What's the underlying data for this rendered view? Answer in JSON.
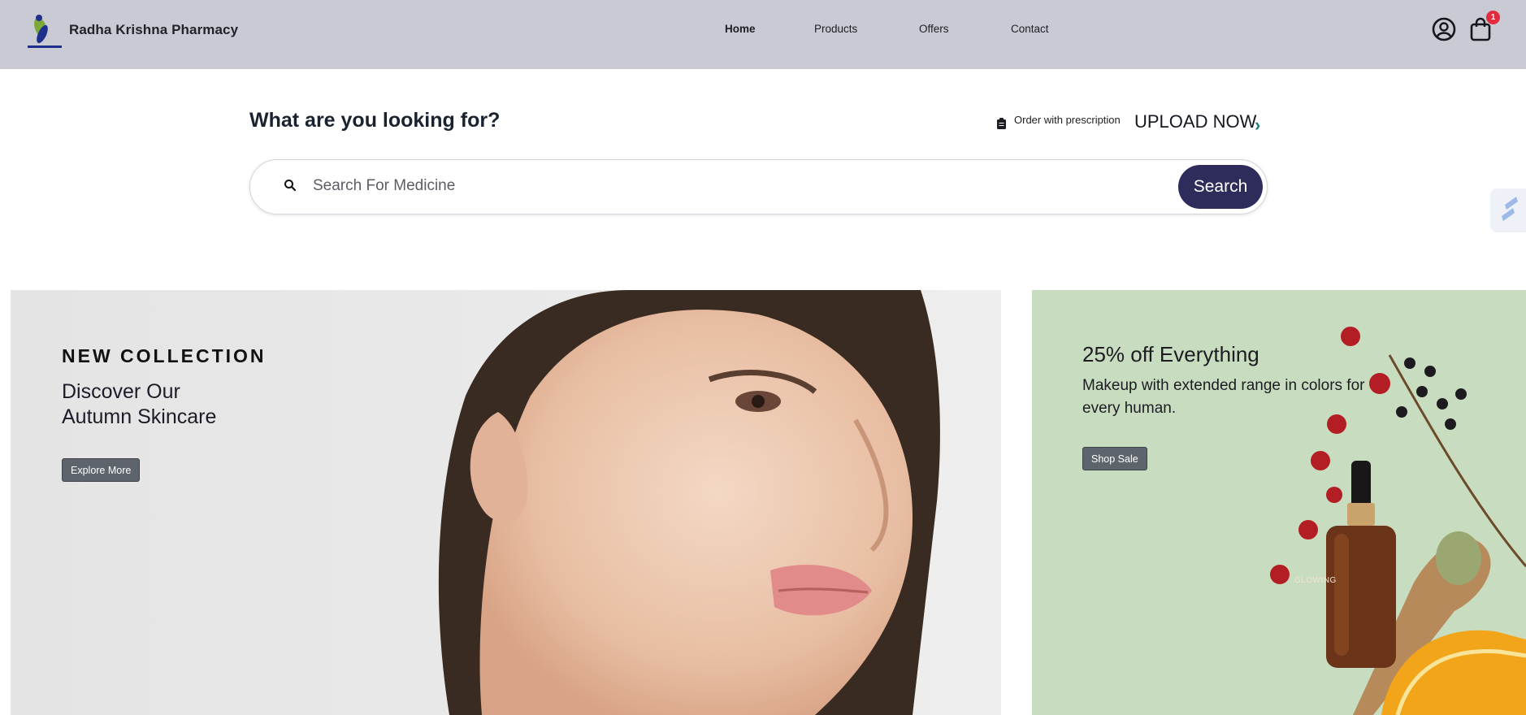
{
  "header": {
    "brand": "Radha Krishna Pharmacy",
    "nav": [
      {
        "label": "Home",
        "active": true
      },
      {
        "label": "Products",
        "active": false
      },
      {
        "label": "Offers",
        "active": false
      },
      {
        "label": "Contact",
        "active": false
      }
    ],
    "cart_count": "1",
    "icons": [
      "user-icon",
      "shopping-bag-icon"
    ],
    "colors": {
      "background": "#c9cad4",
      "badge": "#e22b3d"
    }
  },
  "search_section": {
    "question": "What are you looking for?",
    "prescription_text": "Order with prescription",
    "upload_label": "UPLOAD NOW",
    "upload_chevron": "›",
    "search_placeholder": "Search For Medicine",
    "search_button": "Search",
    "colors": {
      "button": "#2e2c5a",
      "chevron": "#1a7a85"
    }
  },
  "banners": {
    "collection": {
      "eyebrow": "NEW COLLECTION",
      "title_line1": "Discover Our",
      "title_line2": "Autumn Skincare",
      "button": "Explore More"
    },
    "offer": {
      "title": "25% off Everything",
      "subtitle": "Makeup with extended range in colors for every human.",
      "button": "Shop Sale",
      "product_label": "GLOWING"
    }
  }
}
